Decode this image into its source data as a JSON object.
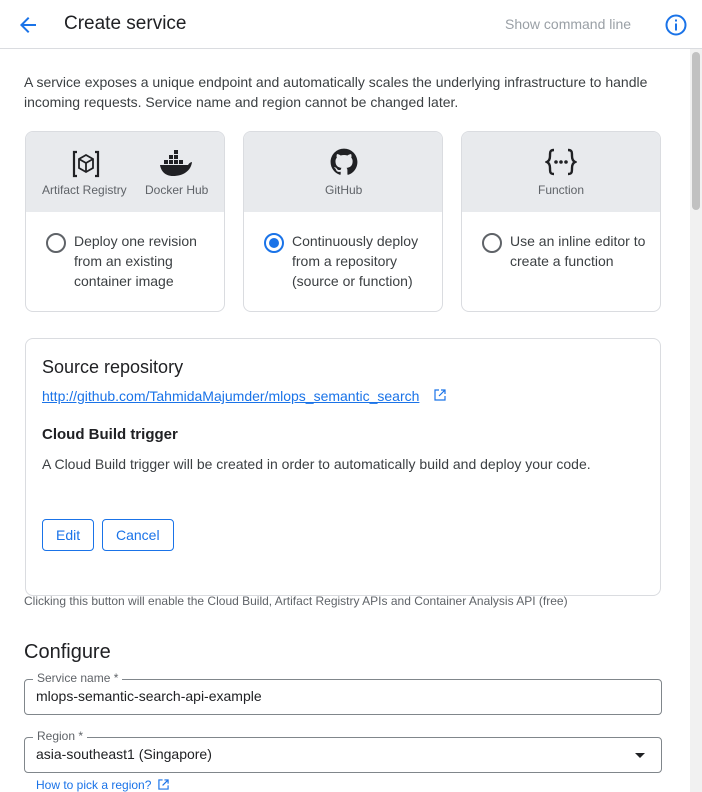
{
  "header": {
    "title": "Create service",
    "command_line": "Show command line"
  },
  "intro": "A service exposes a unique endpoint and automatically scales the underlying infrastructure to handle incoming requests. Service name and region cannot be changed later.",
  "deploy_options": [
    {
      "icons": [
        {
          "label": "Artifact Registry",
          "icon": "artifact-registry-icon"
        },
        {
          "label": "Docker Hub",
          "icon": "docker-icon"
        }
      ],
      "text": "Deploy one revision from an existing container image",
      "selected": false
    },
    {
      "icons": [
        {
          "label": "GitHub",
          "icon": "github-icon"
        }
      ],
      "text": "Continuously deploy from a repository (source or function)",
      "selected": true
    },
    {
      "icons": [
        {
          "label": "Function",
          "icon": "function-icon"
        }
      ],
      "text": "Use an inline editor to create a function",
      "selected": false
    }
  ],
  "source": {
    "title": "Source repository",
    "repo_url": "http://github.com/TahmidaMajumder/mlops_semantic_search",
    "trigger_title": "Cloud Build trigger",
    "trigger_desc": "A Cloud Build trigger will be created in order to automatically build and deploy your code.",
    "edit_label": "Edit",
    "cancel_label": "Cancel"
  },
  "api_note": "Clicking this button will enable the Cloud Build, Artifact Registry APIs and Container Analysis API (free)",
  "configure": {
    "title": "Configure",
    "service_name_label": "Service name *",
    "service_name_value": "mlops-semantic-search-api-example",
    "region_label": "Region *",
    "region_value": "asia-southeast1 (Singapore)",
    "region_help": "How to pick a region?"
  },
  "colors": {
    "accent": "#1a73e8",
    "card_header": "#e8eaed",
    "border": "#dadce0"
  }
}
